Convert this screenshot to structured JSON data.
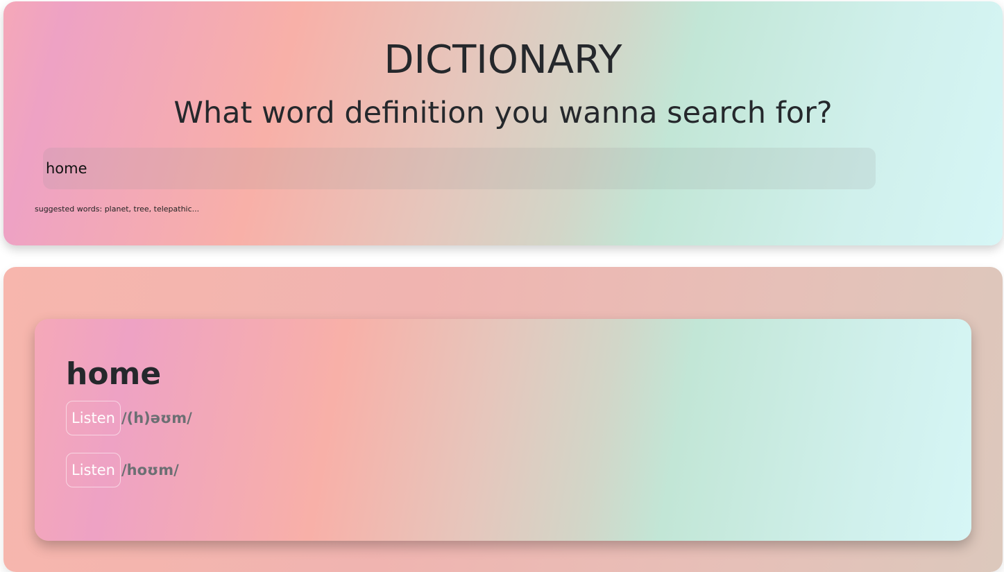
{
  "header": {
    "title": "DICTIONARY",
    "prompt": "What word definition you wanna search for?",
    "search": {
      "value": "home",
      "placeholder": ""
    },
    "hint": "suggested words: planet, tree, telepathic..."
  },
  "result": {
    "word": "home",
    "phonetics": [
      {
        "button_label": "Listen",
        "text": "/(h)əʊm/"
      },
      {
        "button_label": "Listen",
        "text": "/hoʊm/"
      }
    ]
  },
  "colors": {
    "title_text": "#25282c",
    "phonetic_text": "#6c6f73",
    "listen_text": "#ffffff"
  }
}
